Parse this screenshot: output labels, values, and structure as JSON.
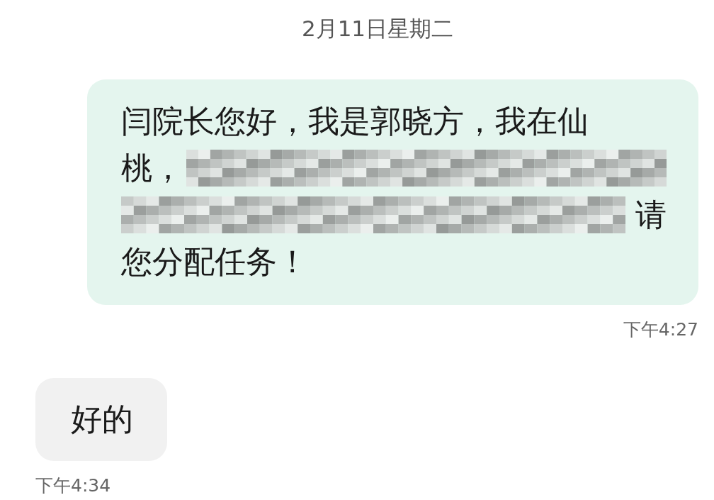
{
  "date_header": "2月11日星期二",
  "messages": [
    {
      "kind": "sent",
      "time": "下午4:27",
      "lines": [
        [
          {
            "kind": "text",
            "text": "闫院长您好，我是郭晓方，我在仙"
          }
        ],
        [
          {
            "kind": "text",
            "text": "桃，"
          },
          {
            "kind": "redacted"
          }
        ],
        [
          {
            "kind": "redacted"
          },
          {
            "kind": "text",
            "text": "请"
          }
        ],
        [
          {
            "kind": "text",
            "text": "您分配任务！"
          }
        ]
      ]
    },
    {
      "kind": "received",
      "time": "下午4:34",
      "lines": [
        [
          {
            "kind": "text",
            "text": "好的"
          }
        ]
      ]
    }
  ]
}
